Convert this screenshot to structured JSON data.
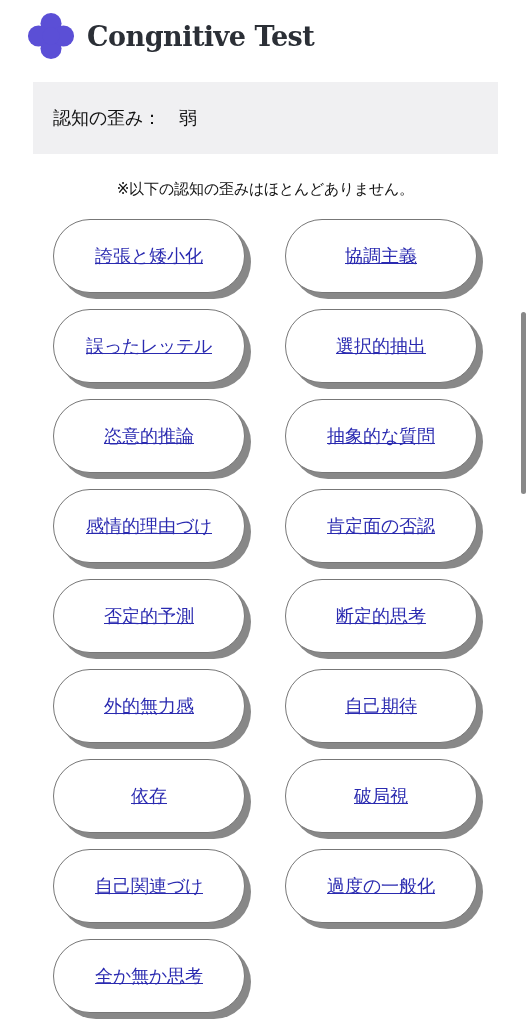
{
  "header": {
    "title": "Congnitive Test"
  },
  "result": {
    "label": "認知の歪み：",
    "value": "弱"
  },
  "note": "※以下の認知の歪みはほとんどありません。",
  "items": [
    {
      "label": "誇張と矮小化"
    },
    {
      "label": "協調主義"
    },
    {
      "label": "誤ったレッテル"
    },
    {
      "label": "選択的抽出"
    },
    {
      "label": "恣意的推論"
    },
    {
      "label": "抽象的な質問"
    },
    {
      "label": "感情的理由づけ"
    },
    {
      "label": "肯定面の否認"
    },
    {
      "label": "否定的予測"
    },
    {
      "label": "断定的思考"
    },
    {
      "label": "外的無力感"
    },
    {
      "label": "自己期待"
    },
    {
      "label": "依存"
    },
    {
      "label": "破局視"
    },
    {
      "label": "自己関連づけ"
    },
    {
      "label": "過度の一般化"
    },
    {
      "label": "全か無か思考"
    }
  ]
}
